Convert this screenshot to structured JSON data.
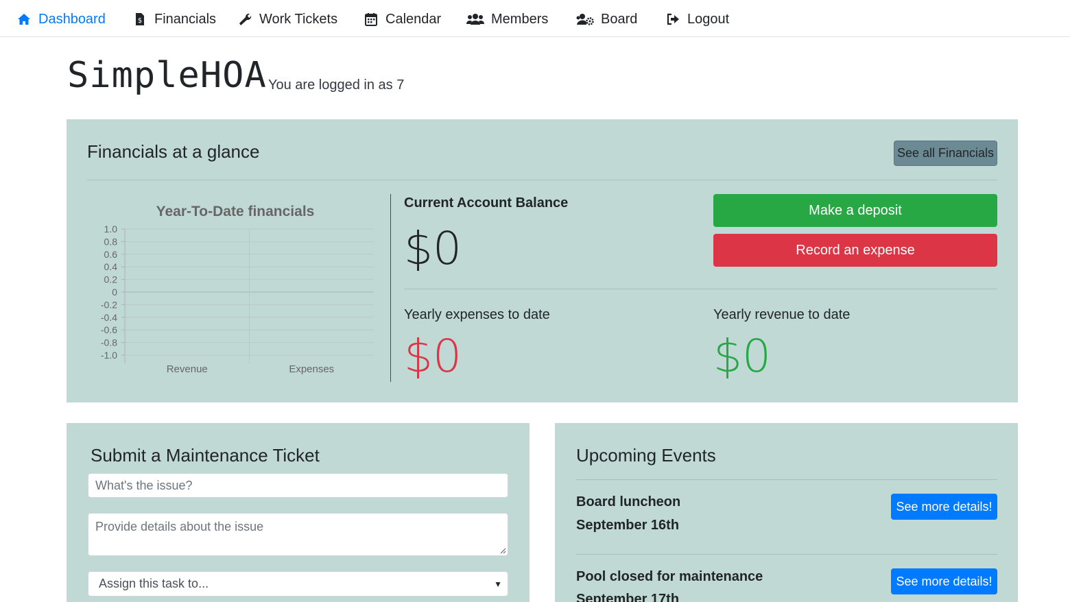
{
  "nav": {
    "items": [
      {
        "label": "Dashboard",
        "icon": "home-icon",
        "active": true
      },
      {
        "label": "Financials",
        "icon": "file-invoice-dollar-icon"
      },
      {
        "label": "Work Tickets",
        "icon": "wrench-icon"
      },
      {
        "label": "Calendar",
        "icon": "calendar-icon"
      },
      {
        "label": "Members",
        "icon": "users-icon"
      },
      {
        "label": "Board",
        "icon": "users-cog-icon"
      },
      {
        "label": "Logout",
        "icon": "sign-out-icon"
      }
    ],
    "active_color": "#007bff"
  },
  "header": {
    "logo": "SimpleHOA",
    "logged_in": "You are logged in as 7"
  },
  "financials": {
    "title": "Financials at a glance",
    "see_all": "See all Financials",
    "balance_label": "Current Account Balance",
    "balance_value": "$0",
    "deposit_button": "Make a deposit",
    "expense_button": "Record an expense",
    "expenses_label": "Yearly expenses to date",
    "expenses_value": "$0",
    "revenue_label": "Yearly revenue to date",
    "revenue_value": "$0",
    "colors": {
      "panel": "#c1d9d5",
      "success": "#28a745",
      "danger": "#dc3545"
    }
  },
  "chart_data": {
    "type": "bar",
    "title": "Year-To-Date financials",
    "categories": [
      "Revenue",
      "Expenses"
    ],
    "values": [
      0,
      0
    ],
    "ylim": [
      -1.0,
      1.0
    ],
    "yticks": [
      "1.0",
      "0.8",
      "0.6",
      "0.4",
      "0.2",
      "0",
      "-0.2",
      "-0.4",
      "-0.6",
      "-0.8",
      "-1.0"
    ],
    "xlabel": "",
    "ylabel": "",
    "grid": true
  },
  "ticket": {
    "title": "Submit a Maintenance Ticket",
    "issue_placeholder": "What's the issue?",
    "details_placeholder": "Provide details about the issue",
    "assign_selected": "Assign this task to..."
  },
  "events": {
    "title": "Upcoming Events",
    "items": [
      {
        "title": "Board luncheon",
        "date": "September 16th",
        "button": "See more details!"
      },
      {
        "title": "Pool closed for maintenance",
        "date": "September 17th",
        "button": "See more details!"
      }
    ]
  }
}
